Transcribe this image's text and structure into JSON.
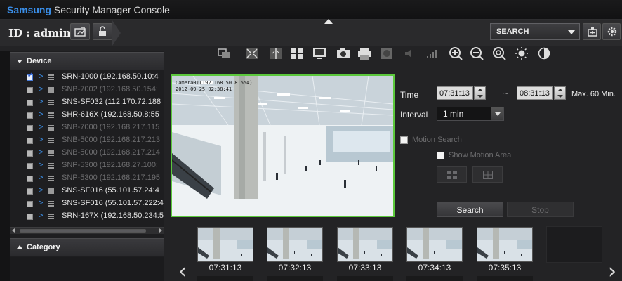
{
  "app": {
    "title_brand": "Samsung",
    "title_rest": " Security Manager Console",
    "minimize_glyph": "–"
  },
  "header": {
    "user_id": "ID : admin",
    "search_select_value": "SEARCH",
    "icons": [
      "user-icon",
      "lock-icon",
      "collapse-up-icon",
      "device-settings-icon",
      "gear-icon"
    ]
  },
  "device_panel": {
    "title": "Device",
    "items": [
      {
        "label": "SRN-1000 (192.168.50.10:4",
        "checked": true,
        "enabled": true
      },
      {
        "label": "SNB-7002 (192.168.50.154:",
        "checked": false,
        "enabled": false
      },
      {
        "label": "SNS-SF032 (112.170.72.188",
        "checked": false,
        "enabled": true
      },
      {
        "label": "SHR-616X (192.168.50.8:55",
        "checked": false,
        "enabled": true
      },
      {
        "label": "SNB-7000 (192.168.217.115",
        "checked": false,
        "enabled": false
      },
      {
        "label": "SNB-5000 (192.168.217.213",
        "checked": false,
        "enabled": false
      },
      {
        "label": "SNB-5000 (192.168.217.214",
        "checked": false,
        "enabled": false
      },
      {
        "label": "SNP-5300 (192.168.27.100:",
        "checked": false,
        "enabled": false
      },
      {
        "label": "SNP-5300 (192.168.217.195",
        "checked": false,
        "enabled": false
      },
      {
        "label": "SNS-SF016 (55.101.57.24:4",
        "checked": false,
        "enabled": true
      },
      {
        "label": "SNS-SF016 (55.101.57.222:4",
        "checked": false,
        "enabled": true
      },
      {
        "label": "SRN-167X (192.168.50.234:5",
        "checked": false,
        "enabled": true
      }
    ]
  },
  "category_panel": {
    "title": "Category"
  },
  "toolbar": {
    "icons": [
      "screen-layout-icon",
      "fullscreen-icon",
      "split-screen-icon",
      "grid-layout-icon",
      "monitor-icon",
      "snapshot-icon",
      "print-icon",
      "record-icon",
      "audio-icon",
      "volume-level-icon",
      "zoom-in-icon",
      "zoom-out-icon",
      "digital-zoom-icon",
      "brightness-icon",
      "contrast-icon"
    ]
  },
  "video": {
    "osd_camera": "Camera01(192.168.50.8:554)",
    "osd_time": "2012-09-25 02:38:41"
  },
  "search_settings": {
    "time_label": "Time",
    "start_time": "07:31:13",
    "range_sep": "~",
    "end_time": "08:31:13",
    "max_note": "Max. 60 Min.",
    "interval_label": "Interval",
    "interval_value": "1 min",
    "motion_search_label": "Motion Search",
    "show_motion_area_label": "Show Motion Area",
    "search_button": "Search",
    "stop_button": "Stop"
  },
  "thumbnails": [
    {
      "time": "07:31:13"
    },
    {
      "time": "07:32:13"
    },
    {
      "time": "07:33:13"
    },
    {
      "time": "07:34:13"
    },
    {
      "time": "07:35:13"
    }
  ],
  "nav": {
    "prev": "‹",
    "next": "›"
  },
  "colors": {
    "accent_blue": "#3a8ee8",
    "selection_green": "#5bc83c",
    "background": "#232325"
  }
}
